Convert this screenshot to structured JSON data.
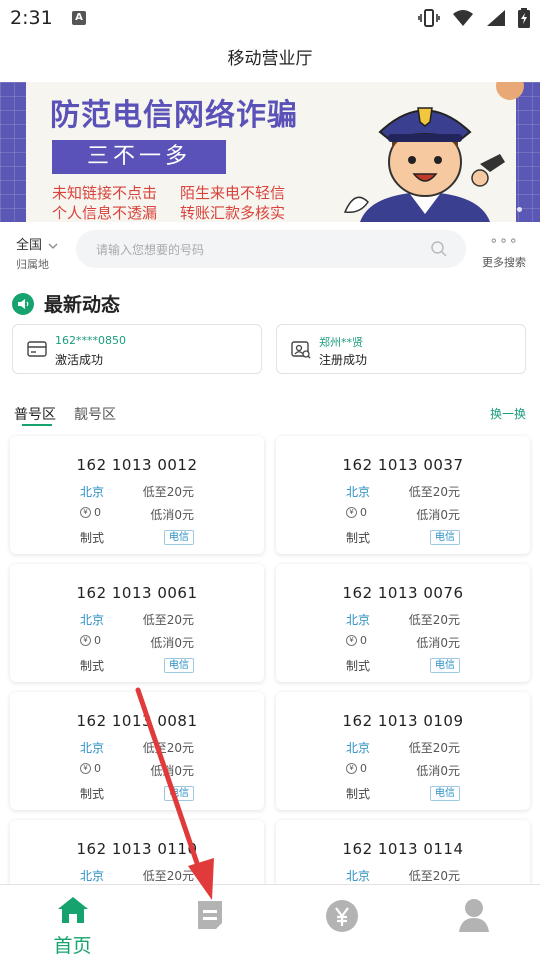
{
  "status": {
    "time": "2:31",
    "a_icon": "A"
  },
  "header": {
    "title": "移动营业厅"
  },
  "banner": {
    "headline": "防范电信网络诈骗",
    "subtitle": "三不一多",
    "lines": [
      "未知链接不点击",
      "陌生来电不轻信",
      "个人信息不透漏",
      "转账汇款多核实"
    ]
  },
  "search": {
    "region": "全国",
    "region_sub": "归属地",
    "placeholder": "请输入您想要的号码",
    "more_label": "更多搜索"
  },
  "news": {
    "title": "最新动态",
    "items": [
      {
        "top": "162****0850",
        "bottom": "激活成功"
      },
      {
        "top": "郑州**贤",
        "bottom": "注册成功"
      }
    ]
  },
  "tabs": {
    "active": "普号区",
    "inactive": "靓号区",
    "swap": "换一换"
  },
  "cards": [
    {
      "number": "162  1013  0012",
      "city": "北京",
      "price": "低至20元",
      "fee": "0",
      "min": "低消0元",
      "sys": "制式",
      "tag": "电信"
    },
    {
      "number": "162  1013  0037",
      "city": "北京",
      "price": "低至20元",
      "fee": "0",
      "min": "低消0元",
      "sys": "制式",
      "tag": "电信"
    },
    {
      "number": "162  1013  0061",
      "city": "北京",
      "price": "低至20元",
      "fee": "0",
      "min": "低消0元",
      "sys": "制式",
      "tag": "电信"
    },
    {
      "number": "162  1013  0076",
      "city": "北京",
      "price": "低至20元",
      "fee": "0",
      "min": "低消0元",
      "sys": "制式",
      "tag": "电信"
    },
    {
      "number": "162  1013  0081",
      "city": "北京",
      "price": "低至20元",
      "fee": "0",
      "min": "低消0元",
      "sys": "制式",
      "tag": "电信"
    },
    {
      "number": "162  1013  0109",
      "city": "北京",
      "price": "低至20元",
      "fee": "0",
      "min": "低消0元",
      "sys": "制式",
      "tag": "电信"
    },
    {
      "number": "162  1013  0110",
      "city": "北京",
      "price": "低至20元",
      "fee": "",
      "min": "",
      "sys": "",
      "tag": ""
    },
    {
      "number": "162  1013  0114",
      "city": "北京",
      "price": "低至20元",
      "fee": "",
      "min": "",
      "sys": "",
      "tag": ""
    }
  ],
  "bottom_nav": {
    "home_label": "首页"
  },
  "colors": {
    "accent": "#17a36e",
    "banner_purple": "#5a52b8",
    "banner_red": "#d9433c",
    "annotation_red": "#e03a3a"
  },
  "icons": {
    "status": [
      "vibrate-icon",
      "wifi-icon",
      "signal-icon",
      "battery-icon"
    ],
    "nav": [
      "home-icon",
      "orders-icon",
      "yen-icon",
      "profile-icon"
    ]
  }
}
